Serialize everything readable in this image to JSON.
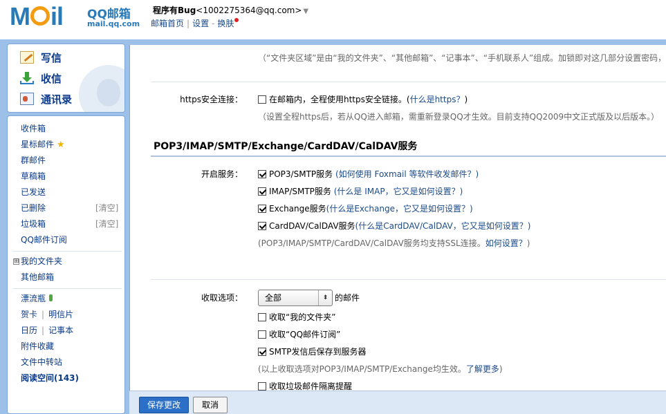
{
  "header": {
    "logo_text": "MOil",
    "brand": "QQ邮箱",
    "domain": "mail.qq.com",
    "user_name": "程序有Bug",
    "user_email": "<1002275364@qq.com>",
    "user_arrow": "▼",
    "links": [
      "邮箱首页",
      "设置",
      "换肤"
    ],
    "separators": [
      "|",
      "-"
    ]
  },
  "sidebar": {
    "compose": "写信",
    "receive": "收信",
    "contacts": "通讯录",
    "folders": {
      "inbox": "收件箱",
      "starred": "星标邮件",
      "group": "群邮件",
      "drafts": "草稿箱",
      "sent": "已发送",
      "deleted": "已删除",
      "deleted_clear": "[清空]",
      "spam": "垃圾箱",
      "spam_clear": "[清空]",
      "subscriptions": "QQ邮件订阅",
      "my_folders_toggle": "⊞",
      "my_folders": "我的文件夹",
      "other_mailbox": "其他邮箱",
      "drift_bottle": "漂流瓶",
      "greeting_card": "贺卡",
      "postcard": "明信片",
      "calendar": "日历",
      "notepad": "记事本",
      "attachments": "附件收藏",
      "file_transfer": "文件中转站",
      "reading_space": "阅读空间(143)"
    }
  },
  "main": {
    "top_note": "（“文件夹区域”是由“我的文件夹”、“其他邮箱”、“记事本”、“手机联系人”组成。加锁即对这几部分设置密码，以",
    "https": {
      "label": "https安全连接：",
      "option": "在邮箱内，全程使用https安全链接。",
      "link_open": "(",
      "link": "什么是https？",
      "link_close": ")",
      "note": "（设置全程https后，若从QQ进入邮箱，需重新登录QQ才生效。目前支持QQ2009中文正式版及以后版本。）"
    },
    "section_title": "POP3/IMAP/SMTP/Exchange/CardDAV/CalDAV服务",
    "services": {
      "label": "开启服务：",
      "items": [
        {
          "name": "POP3/SMTP服务",
          "checked": true,
          "help": "(如何使用 Foxmail 等软件收发邮件？)"
        },
        {
          "name": "IMAP/SMTP服务",
          "checked": true,
          "help": "(什么是 IMAP，它又是如何设置？)"
        },
        {
          "name": "Exchange服务",
          "checked": true,
          "help": "(什么是Exchange，它又是如何设置？)"
        },
        {
          "name": "CardDAV/CalDAV服务",
          "checked": true,
          "help": "(什么是CardDAV/CalDAV，它又是如何设置？)"
        }
      ],
      "note": "(POP3/IMAP/SMTP/CardDAV/CalDAV服务均支持SSL连接。",
      "note_link": "如何设置？",
      "note_close": ")"
    },
    "receive_options": {
      "label": "收取选项：",
      "select_value": "全部",
      "select_suffix": "的邮件",
      "items": [
        {
          "text": "收取“我的文件夹”",
          "checked": false
        },
        {
          "text": "收取“QQ邮件订阅”",
          "checked": false
        },
        {
          "text": "SMTP发信后保存到服务器",
          "checked": true
        }
      ],
      "note": "(以上收取选项对POP3/IMAP/SMTP/Exchange均生效。",
      "note_link": "了解更多",
      "note_close": ")",
      "spam_alert": {
        "text": "收取垃圾邮件隔离提醒",
        "checked": false
      }
    }
  },
  "footer": {
    "save": "保存更改",
    "cancel": "取消"
  },
  "colors": {
    "frame_blue": "#9dc0e8",
    "link_blue": "#1a4a8c",
    "save_button": "#2b6fc7",
    "star": "#f0b400"
  }
}
